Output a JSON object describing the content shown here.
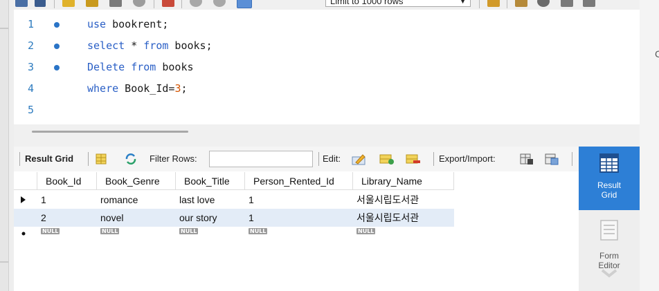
{
  "toolbar": {
    "limit_label": "Limit to 1000 rows"
  },
  "editor": {
    "lines": [
      {
        "number": "1",
        "has_dot": true,
        "tokens": [
          {
            "t": "use",
            "kw": true
          },
          {
            "t": " bookrent;",
            "kw": false
          }
        ]
      },
      {
        "number": "2",
        "has_dot": true,
        "tokens": [
          {
            "t": "select",
            "kw": true
          },
          {
            "t": " * ",
            "kw": false
          },
          {
            "t": "from",
            "kw": true
          },
          {
            "t": " books;",
            "kw": false
          }
        ]
      },
      {
        "number": "3",
        "has_dot": true,
        "tokens": [
          {
            "t": "Delete",
            "kw": true
          },
          {
            "t": " ",
            "kw": false
          },
          {
            "t": "from",
            "kw": true
          },
          {
            "t": " books",
            "kw": false
          }
        ]
      },
      {
        "number": "4",
        "has_dot": false,
        "tokens": [
          {
            "t": "where",
            "kw": true
          },
          {
            "t": " Book_Id=",
            "kw": false
          },
          {
            "t": "3",
            "num": true
          },
          {
            "t": ";",
            "kw": false
          }
        ]
      },
      {
        "number": "5",
        "has_dot": false,
        "tokens": []
      }
    ]
  },
  "result_toolbar": {
    "result_grid": "Result Grid",
    "filter_rows": "Filter Rows:",
    "filter_value": "",
    "edit": "Edit:",
    "export_import": "Export/Import:"
  },
  "grid": {
    "columns": [
      "Book_Id",
      "Book_Genre",
      "Book_Title",
      "Person_Rented_Id",
      "Library_Name"
    ],
    "rows": [
      [
        "1",
        "romance",
        "last love",
        "1",
        "서울시립도서관"
      ],
      [
        "2",
        "novel",
        "our story",
        "1",
        "서울시립도서관"
      ]
    ],
    "null_label": "NULL"
  },
  "side_panel": {
    "result_grid": "Result Grid",
    "form_editor": "Form Editor"
  },
  "colors": {
    "keyword": "#2a5fc6",
    "number": "#d35400",
    "selection_blue": "#2d7fd6",
    "row_highlight": "#e3ecf7"
  }
}
